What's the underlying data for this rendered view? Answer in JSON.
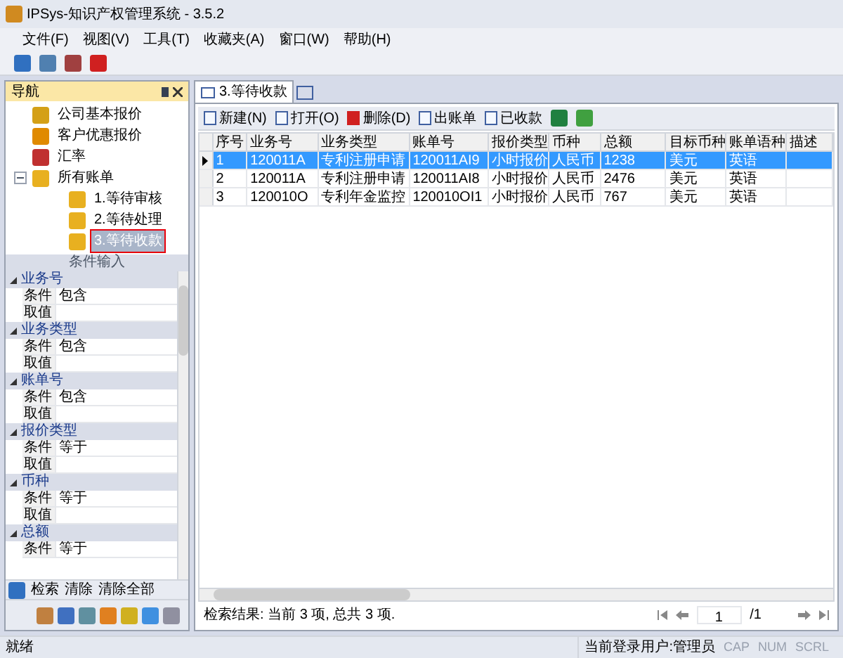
{
  "window": {
    "title": "IPSys-知识产权管理系统 - 3.5.2"
  },
  "menu": [
    "文件(F)",
    "视图(V)",
    "工具(T)",
    "收藏夹(A)",
    "窗口(W)",
    "帮助(H)"
  ],
  "nav": {
    "title": "导航",
    "items": [
      {
        "label": "公司基本报价",
        "selected": false
      },
      {
        "label": "客户优惠报价",
        "selected": false
      },
      {
        "label": "汇率",
        "selected": false
      },
      {
        "label": "所有账单",
        "selected": false,
        "expanded": true,
        "children": [
          {
            "label": "1.等待审核",
            "selected": false
          },
          {
            "label": "2.等待处理",
            "selected": false
          },
          {
            "label": "3.等待收款",
            "selected": true
          }
        ]
      }
    ]
  },
  "conditions": {
    "title": "条件输入",
    "groups": [
      {
        "title": "业务号",
        "rows": [
          {
            "label": "条件",
            "value": "包含"
          },
          {
            "label": "取值",
            "value": ""
          }
        ]
      },
      {
        "title": "业务类型",
        "rows": [
          {
            "label": "条件",
            "value": "包含"
          },
          {
            "label": "取值",
            "value": ""
          }
        ]
      },
      {
        "title": "账单号",
        "rows": [
          {
            "label": "条件",
            "value": "包含"
          },
          {
            "label": "取值",
            "value": ""
          }
        ]
      },
      {
        "title": "报价类型",
        "rows": [
          {
            "label": "条件",
            "value": "等于"
          },
          {
            "label": "取值",
            "value": ""
          }
        ]
      },
      {
        "title": "币种",
        "rows": [
          {
            "label": "条件",
            "value": "等于"
          },
          {
            "label": "取值",
            "value": ""
          }
        ]
      },
      {
        "title": "总额",
        "rows": [
          {
            "label": "条件",
            "value": "等于"
          }
        ]
      }
    ],
    "actions": [
      "检索",
      "清除",
      "清除全部"
    ]
  },
  "document_tab": {
    "label": "3.等待收款"
  },
  "toolbar": [
    "新建(N)",
    "打开(O)",
    "删除(D)",
    "出账单",
    "已收款"
  ],
  "table": {
    "columns": [
      "序号",
      "业务号",
      "业务类型",
      "账单号",
      "报价类型",
      "币种",
      "总额",
      "目标币种",
      "账单语种",
      "描述"
    ],
    "rows": [
      {
        "selected": true,
        "cells": [
          "1",
          "120011A",
          "专利注册申请",
          "120011AI9",
          "小时报价",
          "人民币",
          "1238",
          "美元",
          "英语",
          ""
        ]
      },
      {
        "selected": false,
        "cells": [
          "2",
          "120011A",
          "专利注册申请",
          "120011AI8",
          "小时报价",
          "人民币",
          "2476",
          "美元",
          "英语",
          ""
        ]
      },
      {
        "selected": false,
        "cells": [
          "3",
          "120010O",
          "专利年金监控",
          "120010OI1",
          "小时报价",
          "人民币",
          "767",
          "美元",
          "英语",
          ""
        ]
      }
    ]
  },
  "result": "检索结果: 当前 3 项, 总共 3 项.",
  "pager": {
    "page": "1",
    "total": "/1"
  },
  "status_bar": {
    "text": "就绪",
    "user": "当前登录用户:管理员",
    "indicators": [
      {
        "label": "CAP",
        "enabled": false
      },
      {
        "label": "NUM",
        "enabled": false
      },
      {
        "label": "SCRL",
        "enabled": false
      }
    ]
  }
}
